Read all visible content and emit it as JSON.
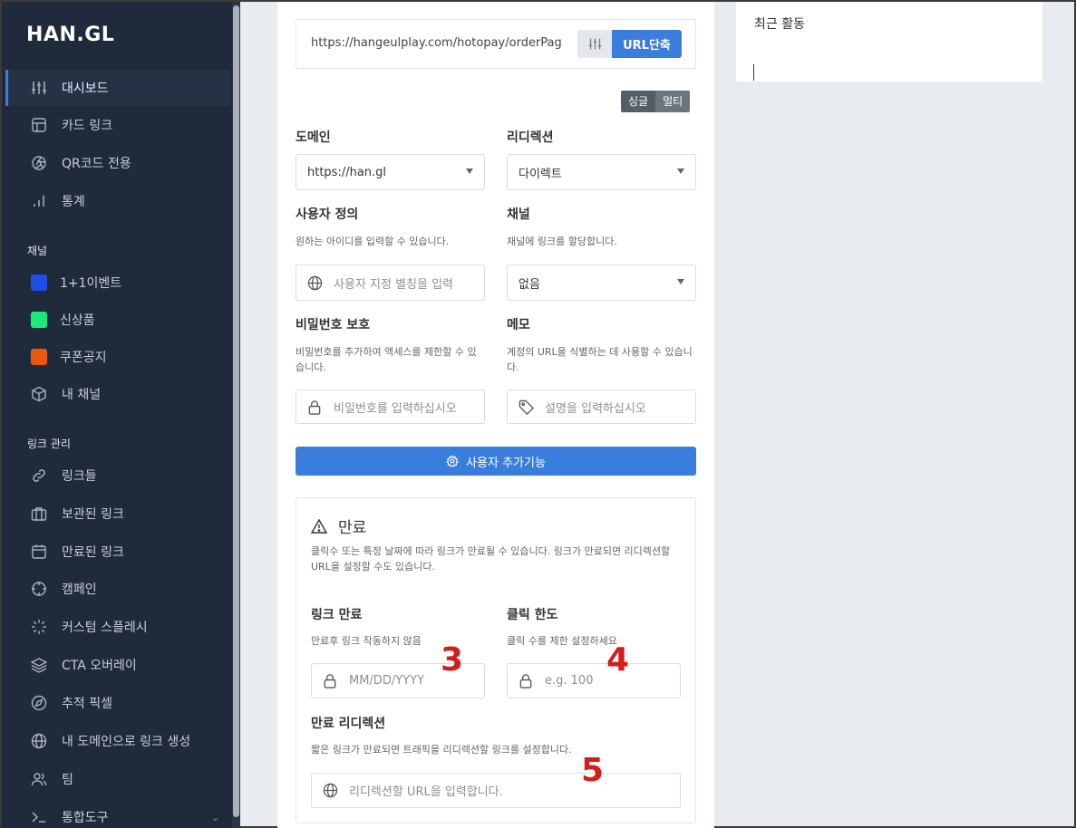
{
  "brand": {
    "logo": "HAN.GL"
  },
  "sidebar": {
    "main_items": [
      {
        "label": "대시보드",
        "icon": "sliders-icon"
      },
      {
        "label": "카드 링크",
        "icon": "layout-icon"
      },
      {
        "label": "QR코드 전용",
        "icon": "aperture-icon"
      },
      {
        "label": "통계",
        "icon": "bar-chart-icon"
      }
    ],
    "channel_section": "채널",
    "channels": [
      {
        "label": "1+1이벤트",
        "color": "#1f4de8"
      },
      {
        "label": "신상품",
        "color": "#1de87a"
      },
      {
        "label": "쿠폰공지",
        "color": "#ea580c"
      },
      {
        "label": "내 채널",
        "icon": "box-icon"
      }
    ],
    "links_section": "링크 관리",
    "link_items": [
      {
        "label": "링크들",
        "icon": "link-icon"
      },
      {
        "label": "보관된 링크",
        "icon": "briefcase-icon"
      },
      {
        "label": "만료된 링크",
        "icon": "calendar-icon"
      },
      {
        "label": "캠페인",
        "icon": "crosshair-icon"
      },
      {
        "label": "커스텀 스플레시",
        "icon": "loader-icon"
      },
      {
        "label": "CTA 오버레이",
        "icon": "layers-icon"
      },
      {
        "label": "추적 픽셀",
        "icon": "compass-icon"
      },
      {
        "label": "내 도메인으로 링크 생성",
        "icon": "globe-icon"
      },
      {
        "label": "팀",
        "icon": "users-icon"
      },
      {
        "label": "통합도구",
        "icon": "terminal-icon"
      }
    ]
  },
  "shortener": {
    "url_value": "https://hangeulplay.com/hotopay/orderPag",
    "shorten_label": "URL단축",
    "mode_single": "싱글",
    "mode_multi": "멀티"
  },
  "form": {
    "domain_label": "도메인",
    "domain_value": "https://han.gl",
    "redirect_label": "리디렉션",
    "redirect_value": "다이렉트",
    "custom_label": "사용자 정의",
    "custom_hint": "원하는 아이디를 입력할 수 있습니다.",
    "custom_placeholder": "사용자 지정 별칭을 입력",
    "channel_label": "채널",
    "channel_hint": "채널에 링크를 할당합니다.",
    "channel_value": "없음",
    "password_label": "비밀번호 보호",
    "password_hint": "비밀번호를 추가하여 액세스를 제한할 수 있습니다.",
    "password_placeholder": "비밀번호를 입력하십시오",
    "memo_label": "메모",
    "memo_hint": "계정의 URL을 식별하는 데 사용할 수 있습니다.",
    "memo_placeholder": "설명을 입력하십시오",
    "advanced_label": "사용자 추가기능"
  },
  "expiry": {
    "title": "만료",
    "description": "클릭수 또는 특정 날짜에 따라 링크가 만료될 수 있습니다. 링크가 만료되면 리디렉션할 URL을 설정할 수도 있습니다.",
    "link_expiry_label": "링크 만료",
    "link_expiry_hint": "만료후 링크 작동하지 않음",
    "date_placeholder": "MM/DD/YYYY",
    "click_limit_label": "클릭 한도",
    "click_limit_hint": "클릭 수를 제한 설정하세요",
    "click_placeholder": "e.g. 100",
    "redirect_label": "만료 리디렉션",
    "redirect_hint": "짧은 링크가 만료되면 트래픽을 리디렉션할 링크를 설정합니다.",
    "redirect_placeholder": "리디렉션할 URL을 입력합니다."
  },
  "annotations": {
    "a3": "3",
    "a4": "4",
    "a5": "5"
  },
  "activity": {
    "title": "최근 활동"
  }
}
